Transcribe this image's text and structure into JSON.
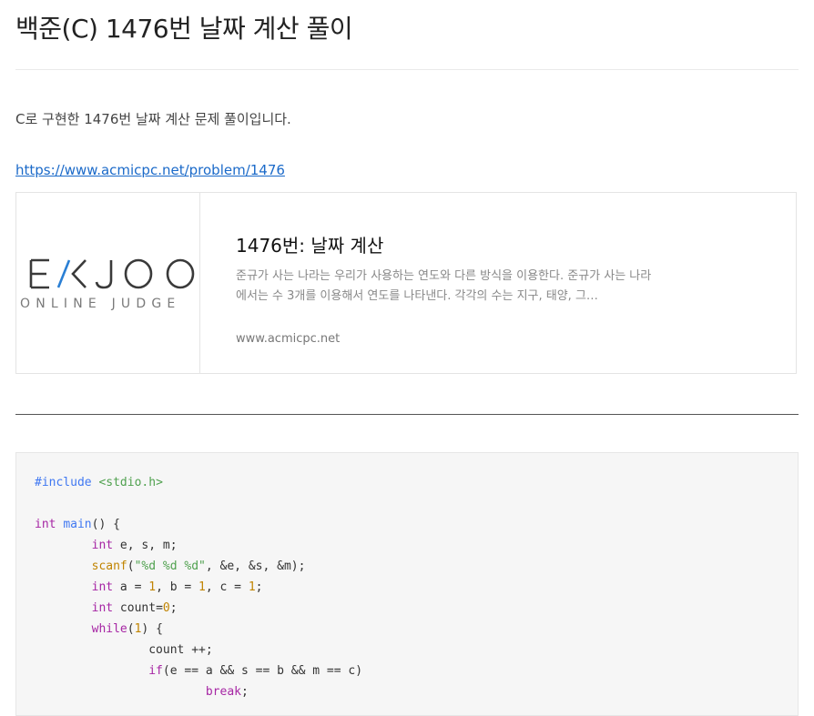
{
  "post": {
    "title": "백준(C) 1476번 날짜 계산 풀이",
    "intro": "C로 구현한 1476번 날짜 계산 문제 풀이입니다.",
    "link": "https://www.acmicpc.net/problem/1476"
  },
  "card": {
    "logo_main": "E/KJOO",
    "logo_sub": "ONLINE JUDGE",
    "title": "1476번: 날짜 계산",
    "description": "준규가 사는 나라는 우리가 사용하는 연도와 다른 방식을 이용한다. 준규가 사는 나라에서는 수 3개를 이용해서 연도를 나타낸다. 각각의 수는 지구, 태양, 그…",
    "domain": "www.acmicpc.net"
  },
  "code": {
    "line1_pp": "#include",
    "line1_hdr": "<stdio.h>",
    "l3_type": "int",
    "l3_name": "main",
    "l3_rest": "() {",
    "l4_type": "int",
    "l4_rest": " e, s, m;",
    "l5_fn": "scanf",
    "l5_open": "(",
    "l5_str": "\"%d %d %d\"",
    "l5_rest": ", &e, &s, &m);",
    "l6_type": "int",
    "l6_a": " a = ",
    "l6_n1": "1",
    "l6_b": ", b = ",
    "l6_n2": "1",
    "l6_c": ", c = ",
    "l6_n3": "1",
    "l6_end": ";",
    "l7_type": "int",
    "l7_rest": " count=",
    "l7_num": "0",
    "l7_end": ";",
    "l8_kw": "while",
    "l8_open": "(",
    "l8_num": "1",
    "l8_rest": ") {",
    "l9": "count ++;",
    "l10_kw": "if",
    "l10_rest": "(e == a && s == b && m == c)",
    "l11_kw": "break",
    "l11_end": ";"
  }
}
